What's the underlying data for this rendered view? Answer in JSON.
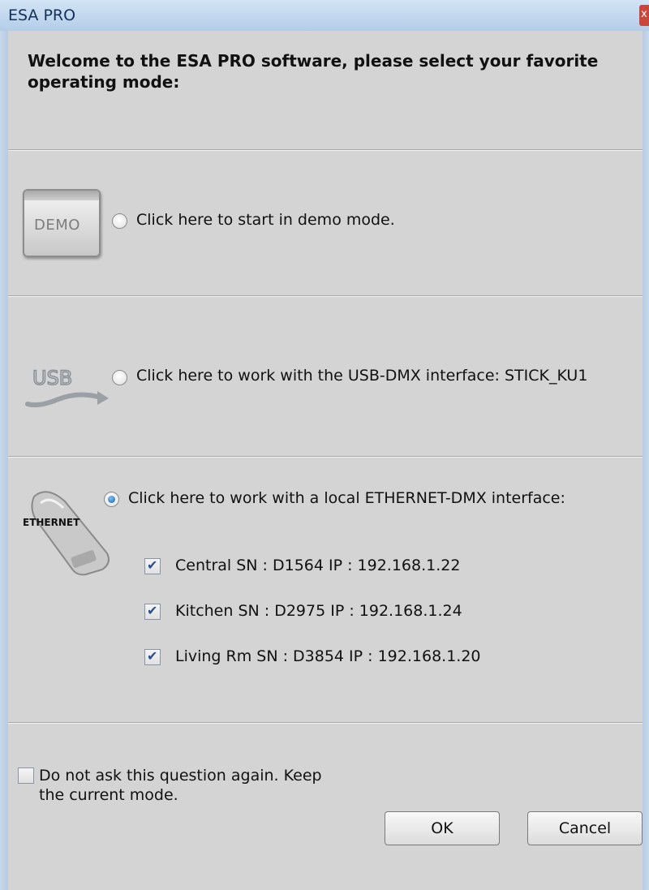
{
  "window": {
    "title": "ESA PRO",
    "close_glyph": "x"
  },
  "welcome_text": "Welcome to the ESA PRO software, please select your favorite operating mode:",
  "options": {
    "demo": {
      "icon_text": "DEMO",
      "label": "Click here to start in demo mode.",
      "selected": false
    },
    "usb": {
      "icon_text": "USB",
      "label": "Click here to work with the USB-DMX interface:  STICK_KU1",
      "selected": false
    },
    "ethernet": {
      "icon_text": "ETHERNET",
      "label": "Click here to work with a local ETHERNET-DMX interface:",
      "selected": true,
      "devices": [
        {
          "label": "Central  SN : D1564  IP : 192.168.1.22",
          "checked": true
        },
        {
          "label": "Kitchen  SN : D2975  IP : 192.168.1.24",
          "checked": true
        },
        {
          "label": "Living Rm  SN : D3854  IP : 192.168.1.20",
          "checked": true
        }
      ]
    }
  },
  "footer": {
    "dont_ask_label": "Do not ask this question again. Keep the current mode.",
    "dont_ask_checked": false,
    "ok_label": "OK",
    "cancel_label": "Cancel"
  }
}
